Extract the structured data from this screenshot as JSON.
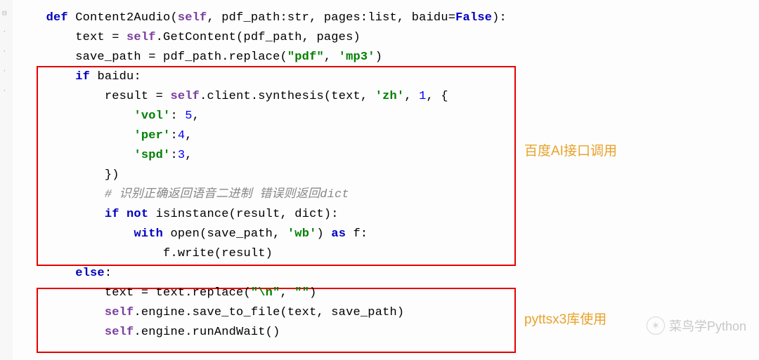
{
  "code": {
    "lines": [
      {
        "indent": 1,
        "tokens": [
          {
            "t": "def ",
            "c": "def"
          },
          {
            "t": "Content2Audio(",
            "c": "p"
          },
          {
            "t": "self",
            "c": "self"
          },
          {
            "t": ", pdf_path:",
            "c": "p"
          },
          {
            "t": "str",
            "c": "type"
          },
          {
            "t": ", pages:",
            "c": "p"
          },
          {
            "t": "list",
            "c": "type"
          },
          {
            "t": ", baidu=",
            "c": "p"
          },
          {
            "t": "False",
            "c": "bool"
          },
          {
            "t": "):",
            "c": "p"
          }
        ]
      },
      {
        "indent": 2,
        "tokens": [
          {
            "t": "text = ",
            "c": "p"
          },
          {
            "t": "self",
            "c": "self"
          },
          {
            "t": ".GetContent(pdf_path, pages)",
            "c": "p"
          }
        ]
      },
      {
        "indent": 2,
        "tokens": [
          {
            "t": "save_path = pdf_path.replace(",
            "c": "p"
          },
          {
            "t": "\"pdf\"",
            "c": "str"
          },
          {
            "t": ", ",
            "c": "p"
          },
          {
            "t": "'mp3'",
            "c": "str"
          },
          {
            "t": ")",
            "c": "p"
          }
        ]
      },
      {
        "indent": 2,
        "tokens": [
          {
            "t": "if ",
            "c": "kw"
          },
          {
            "t": "baidu:",
            "c": "p"
          }
        ]
      },
      {
        "indent": 3,
        "tokens": [
          {
            "t": "result = ",
            "c": "p"
          },
          {
            "t": "self",
            "c": "self"
          },
          {
            "t": ".client.synthesis(text, ",
            "c": "p"
          },
          {
            "t": "'zh'",
            "c": "str"
          },
          {
            "t": ", ",
            "c": "p"
          },
          {
            "t": "1",
            "c": "num"
          },
          {
            "t": ", {",
            "c": "p"
          }
        ]
      },
      {
        "indent": 4,
        "tokens": [
          {
            "t": "'vol'",
            "c": "str"
          },
          {
            "t": ": ",
            "c": "p"
          },
          {
            "t": "5",
            "c": "num"
          },
          {
            "t": ",",
            "c": "p"
          }
        ]
      },
      {
        "indent": 4,
        "tokens": [
          {
            "t": "'per'",
            "c": "str"
          },
          {
            "t": ":",
            "c": "p"
          },
          {
            "t": "4",
            "c": "num"
          },
          {
            "t": ",",
            "c": "p"
          }
        ]
      },
      {
        "indent": 4,
        "tokens": [
          {
            "t": "'spd'",
            "c": "str"
          },
          {
            "t": ":",
            "c": "p"
          },
          {
            "t": "3",
            "c": "num"
          },
          {
            "t": ",",
            "c": "p"
          }
        ]
      },
      {
        "indent": 3,
        "tokens": [
          {
            "t": "})",
            "c": "p"
          }
        ]
      },
      {
        "indent": 3,
        "tokens": [
          {
            "t": "# 识别正确返回语音二进制 错误则返回dict",
            "c": "cmt"
          }
        ]
      },
      {
        "indent": 3,
        "tokens": [
          {
            "t": "if not ",
            "c": "kw"
          },
          {
            "t": "isinstance",
            "c": "type"
          },
          {
            "t": "(result, ",
            "c": "p"
          },
          {
            "t": "dict",
            "c": "type"
          },
          {
            "t": "):",
            "c": "p"
          }
        ]
      },
      {
        "indent": 4,
        "tokens": [
          {
            "t": "with ",
            "c": "kw"
          },
          {
            "t": "open",
            "c": "type"
          },
          {
            "t": "(save_path, ",
            "c": "p"
          },
          {
            "t": "'wb'",
            "c": "str"
          },
          {
            "t": ") ",
            "c": "p"
          },
          {
            "t": "as ",
            "c": "kw"
          },
          {
            "t": "f:",
            "c": "p"
          }
        ]
      },
      {
        "indent": 5,
        "tokens": [
          {
            "t": "f.write(result)",
            "c": "p"
          }
        ]
      },
      {
        "indent": 2,
        "tokens": [
          {
            "t": "else",
            "c": "kw"
          },
          {
            "t": ":",
            "c": "p"
          }
        ]
      },
      {
        "indent": 3,
        "tokens": [
          {
            "t": "text = text.replace(",
            "c": "p"
          },
          {
            "t": "\"\\n\"",
            "c": "str"
          },
          {
            "t": ", ",
            "c": "p"
          },
          {
            "t": "\"\"",
            "c": "str"
          },
          {
            "t": ")",
            "c": "p"
          }
        ]
      },
      {
        "indent": 3,
        "tokens": [
          {
            "t": "self",
            "c": "self"
          },
          {
            "t": ".engine.save_to_file(text, save_path)",
            "c": "p"
          }
        ]
      },
      {
        "indent": 3,
        "tokens": [
          {
            "t": "self",
            "c": "self"
          },
          {
            "t": ".engine.runAndWait()",
            "c": "p"
          }
        ]
      }
    ]
  },
  "annotations": {
    "box1_label": "百度AI接口调用",
    "box2_label": "pyttsx3库使用"
  },
  "watermark": {
    "text": "菜鸟学Python"
  }
}
